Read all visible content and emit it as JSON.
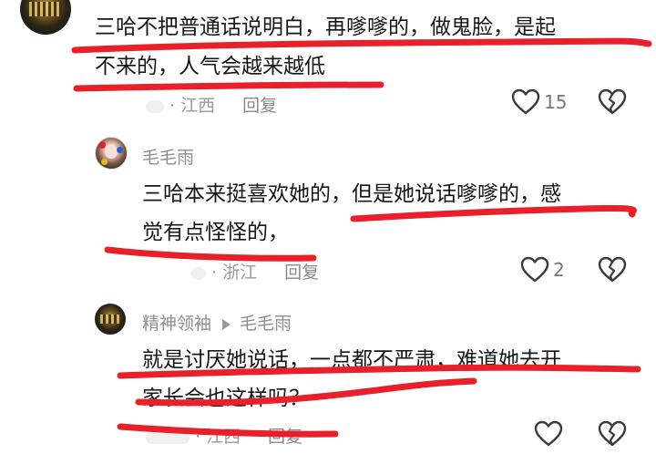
{
  "comment1": {
    "text_line1": "三哈不把普通话说明白，再嗲嗲的，做鬼脸，是起",
    "text_line2": "不来的，人气会越来越低",
    "location": "江西",
    "reply_label": "回复",
    "like_count": "15"
  },
  "comment2": {
    "username": "毛毛雨",
    "text_line1": "三哈本来挺喜欢她的，但是她说话嗲嗲的，感",
    "text_line2": "觉有点怪怪的，",
    "location": "浙江",
    "reply_label": "回复",
    "like_count": "2"
  },
  "comment3": {
    "username": "精神领袖",
    "reply_to": "毛毛雨",
    "text_line1": "就是讨厌她说话，一点都不严肃，难道她去开",
    "text_line2": "家长会也这样吗？",
    "location": "江西",
    "reply_label": "回复"
  },
  "colors": {
    "highlight_red": "#e8202a",
    "text": "#161616",
    "muted": "#9a9a9a"
  },
  "icons": [
    "heart-outline-icon",
    "broken-heart-icon",
    "reply-arrow-icon"
  ]
}
